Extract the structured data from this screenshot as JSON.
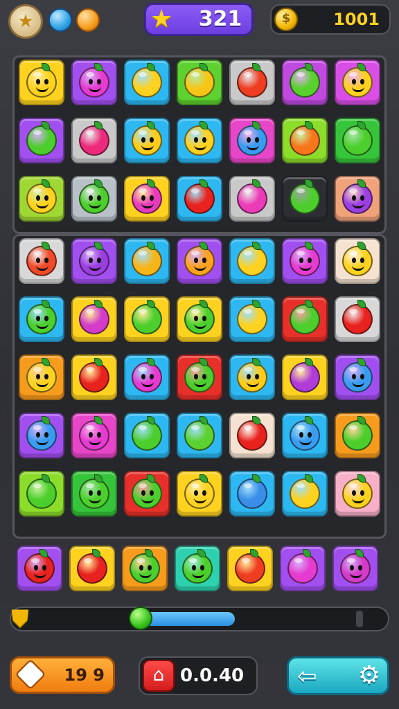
{
  "header": {
    "avatar_icon": "golden-shield-avatar-icon",
    "gem_icons": [
      "blue-gem-icon",
      "orange-gem-icon"
    ],
    "score": "321",
    "score_icon": "star-icon",
    "coins": "1001",
    "coin_icon": "coin-icon"
  },
  "boards": [
    {
      "rows": [
        [
          {
            "c": "#ffd21f",
            "f": "#ffd21f",
            "face": true
          },
          {
            "c": "#a24ff0",
            "f": "#e63bd0",
            "face": true
          },
          {
            "c": "#2db8f2",
            "f": "#ffd21f",
            "face": false
          },
          {
            "c": "#5cd12f",
            "f": "#f7c516",
            "face": false
          },
          {
            "c": "#c9c9c9",
            "f": "#ef3d22",
            "face": false
          },
          {
            "c": "#c04ae0",
            "f": "#58d12c",
            "face": false
          },
          {
            "c": "#d94ee6",
            "f": "#ffd21f",
            "face": true
          }
        ],
        [
          {
            "c": "#a24ff0",
            "f": "#4ccf2c",
            "face": false
          },
          {
            "c": "#c9c9c9",
            "f": "#ec2a7c",
            "face": false
          },
          {
            "c": "#2db8f2",
            "f": "#ffcc1a",
            "face": true
          },
          {
            "c": "#2db8f2",
            "f": "#ffd21f",
            "face": true
          },
          {
            "c": "#e846c8",
            "f": "#3a9cf0",
            "face": true
          },
          {
            "c": "#8cdc2a",
            "f": "#f7761a",
            "face": false
          },
          {
            "c": "#36c43a",
            "f": "#4ccf2c",
            "face": false
          }
        ],
        [
          {
            "c": "#9fd832",
            "f": "#ffd21f",
            "face": true
          },
          {
            "c": "#b8c0c8",
            "f": "#4ccf2c",
            "face": true
          },
          {
            "c": "#ffd21f",
            "f": "#e83bbd",
            "face": true
          },
          {
            "c": "#2db8f2",
            "f": "#e8221e",
            "face": false
          },
          {
            "c": "#c9c9c9",
            "f": "#ec3bb6",
            "face": false
          },
          {
            "c": "#2d2e33",
            "f": "#4ccf2c",
            "face": false
          },
          {
            "c": "#f0a27a",
            "f": "#9c3fe0",
            "face": true
          }
        ]
      ]
    },
    {
      "rows": [
        [
          {
            "c": "#d8d8d8",
            "f": "#ef4a2a",
            "face": true
          },
          {
            "c": "#a24ff0",
            "f": "#9c3fe0",
            "face": true
          },
          {
            "c": "#2db8f2",
            "f": "#f7b51a",
            "face": false
          },
          {
            "c": "#a24ff0",
            "f": "#ffa21f",
            "face": true
          },
          {
            "c": "#2db8f2",
            "f": "#ffd21f",
            "face": false
          },
          {
            "c": "#a24ff0",
            "f": "#e63bd0",
            "face": true
          },
          {
            "c": "#f5e2d0",
            "f": "#ffd21f",
            "face": true
          }
        ],
        [
          {
            "c": "#2db8f2",
            "f": "#4ccf2c",
            "face": true
          },
          {
            "c": "#ffd21f",
            "f": "#d33bc8",
            "face": false
          },
          {
            "c": "#ffd21f",
            "f": "#4ccf2c",
            "face": false
          },
          {
            "c": "#ffd21f",
            "f": "#4ccf2c",
            "face": true
          },
          {
            "c": "#2db8f2",
            "f": "#ffd21f",
            "face": false
          },
          {
            "c": "#e8302a",
            "f": "#4ccf2c",
            "face": false
          },
          {
            "c": "#d8d8d8",
            "f": "#e8221e",
            "face": false
          }
        ],
        [
          {
            "c": "#f79b1c",
            "f": "#ffd21f",
            "face": true
          },
          {
            "c": "#ffd21f",
            "f": "#e8221e",
            "face": false
          },
          {
            "c": "#2db8f2",
            "f": "#e63bd0",
            "face": true
          },
          {
            "c": "#e8302a",
            "f": "#4ccf2c",
            "face": true
          },
          {
            "c": "#2db8f2",
            "f": "#ffcc1a",
            "face": true
          },
          {
            "c": "#ffd21f",
            "f": "#b13bd8",
            "face": false
          },
          {
            "c": "#a24ff0",
            "f": "#3a9cf0",
            "face": true
          }
        ],
        [
          {
            "c": "#a24ff0",
            "f": "#3a9cf0",
            "face": true
          },
          {
            "c": "#e846c8",
            "f": "#e63bd0",
            "face": true
          },
          {
            "c": "#2db8f2",
            "f": "#4ccf2c",
            "face": false
          },
          {
            "c": "#2db8f2",
            "f": "#5cd12f",
            "face": false
          },
          {
            "c": "#f5e2d0",
            "f": "#e8221e",
            "face": false
          },
          {
            "c": "#2db8f2",
            "f": "#3a9cf0",
            "face": true
          },
          {
            "c": "#f79b1c",
            "f": "#4ccf2c",
            "face": false
          }
        ],
        [
          {
            "c": "#8cdc2a",
            "f": "#4ccf2c",
            "face": false
          },
          {
            "c": "#36c43a",
            "f": "#4ccf2c",
            "face": true
          },
          {
            "c": "#e8302a",
            "f": "#4ccf2c",
            "face": true
          },
          {
            "c": "#ffd21f",
            "f": "#ffd21f",
            "face": true
          },
          {
            "c": "#2db8f2",
            "f": "#3a8ee8",
            "face": false
          },
          {
            "c": "#2db8f2",
            "f": "#ffd21f",
            "face": false
          },
          {
            "c": "#f7b0c8",
            "f": "#ffd21f",
            "face": true
          }
        ]
      ]
    }
  ],
  "tray": [
    {
      "c": "#a24ff0",
      "f": "#e8221e",
      "face": true
    },
    {
      "c": "#ffd21f",
      "f": "#e8221e",
      "face": false
    },
    {
      "c": "#f79b1c",
      "f": "#4ccf2c",
      "face": true
    },
    {
      "c": "#2dd1b0",
      "f": "#4ccf2c",
      "face": true
    },
    {
      "c": "#ffd21f",
      "f": "#ef3d22",
      "face": false
    },
    {
      "c": "#a24ff0",
      "f": "#e63bd0",
      "face": false
    },
    {
      "c": "#a24ff0",
      "f": "#d33bc8",
      "face": true
    }
  ],
  "progress": {
    "level_fraction": 0.33,
    "shield_icon": "shield-icon",
    "knob_icon": "green-orb-icon"
  },
  "footer": {
    "moves_icon": "diamond-icon",
    "moves": "19 9",
    "timer_icon": "house-icon",
    "timer": "0.0.40",
    "back_icon": "back-arrow-icon",
    "settings_icon": "gear-icon"
  }
}
